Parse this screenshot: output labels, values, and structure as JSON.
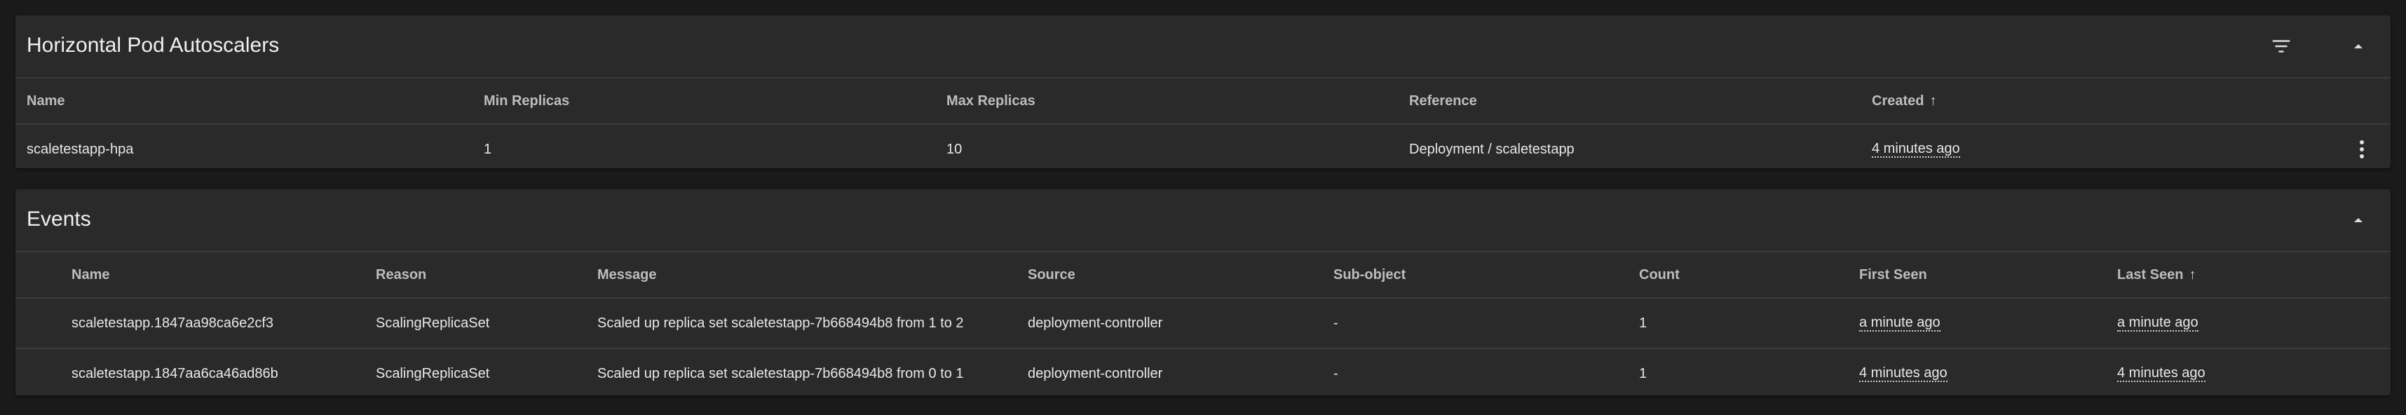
{
  "hpa": {
    "title": "Horizontal Pod Autoscalers",
    "columns": {
      "name": "Name",
      "min_replicas": "Min Replicas",
      "max_replicas": "Max Replicas",
      "reference": "Reference",
      "created": "Created",
      "created_sort": "↑"
    },
    "rows": [
      {
        "name": "scaletestapp-hpa",
        "min_replicas": "1",
        "max_replicas": "10",
        "reference": "Deployment / scaletestapp",
        "created": "4 minutes ago"
      }
    ]
  },
  "events": {
    "title": "Events",
    "columns": {
      "name": "Name",
      "reason": "Reason",
      "message": "Message",
      "source": "Source",
      "sub_object": "Sub-object",
      "count": "Count",
      "first_seen": "First Seen",
      "last_seen": "Last Seen",
      "last_seen_sort": "↑"
    },
    "rows": [
      {
        "name": "scaletestapp.1847aa98ca6e2cf3",
        "reason": "ScalingReplicaSet",
        "message": "Scaled up replica set scaletestapp-7b668494b8 from 1 to 2",
        "source": "deployment-controller",
        "sub_object": "-",
        "count": "1",
        "first_seen": "a minute ago",
        "last_seen": "a minute ago"
      },
      {
        "name": "scaletestapp.1847aa6ca46ad86b",
        "reason": "ScalingReplicaSet",
        "message": "Scaled up replica set scaletestapp-7b668494b8 from 0 to 1",
        "source": "deployment-controller",
        "sub_object": "-",
        "count": "1",
        "first_seen": "4 minutes ago",
        "last_seen": "4 minutes ago"
      }
    ]
  },
  "icons": {
    "filter": "filter-icon",
    "collapse": "chevron-up-icon",
    "menu": "more-vert-icon"
  }
}
